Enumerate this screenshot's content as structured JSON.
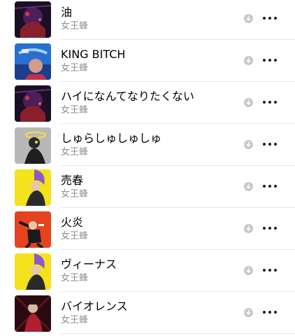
{
  "songs": [
    {
      "title": "油",
      "artist": "女王蜂",
      "artwork": "dark-purple-red-cover"
    },
    {
      "title": "KING BITCH",
      "artist": "女王蜂",
      "artwork": "blue-graffiti-cover"
    },
    {
      "title": "ハイになんてなりたくない",
      "artist": "女王蜂",
      "artwork": "dark-purple-red-cover"
    },
    {
      "title": "しゅらしゅしゅしゅ",
      "artist": "女王蜂",
      "artwork": "grey-halo-figure-cover"
    },
    {
      "title": "売春",
      "artist": "女王蜂",
      "artwork": "yellow-purple-hair-cover"
    },
    {
      "title": "火炎",
      "artist": "女王蜂",
      "artwork": "red-orange-dancer-cover"
    },
    {
      "title": "ヴィーナス",
      "artist": "女王蜂",
      "artwork": "yellow-purple-hair-cover"
    },
    {
      "title": "バイオレンス",
      "artist": "女王蜂",
      "artwork": "dark-red-figure-cover"
    }
  ],
  "icons": {
    "download": "download-arrow-icon",
    "more": "more-ellipsis-icon"
  },
  "colors": {
    "artist_text": "#8e8e93",
    "download_badge": "#c7c7cc",
    "separator": "#e5e5ea"
  }
}
